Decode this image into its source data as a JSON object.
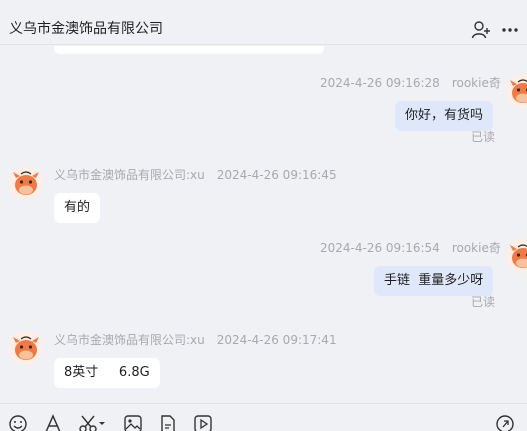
{
  "header": {
    "title": "义乌市金澳饰品有限公司",
    "icons": [
      "add-user-icon",
      "more-icon"
    ]
  },
  "messages": [
    {
      "side": "right",
      "time": "2024-4-26 09:16:28",
      "sender": "rookie奇",
      "text": "你好，有货吗",
      "status": "已读"
    },
    {
      "side": "left",
      "time": "2024-4-26 09:16:45",
      "sender": "义乌市金澳饰品有限公司:xu",
      "text": "有的"
    },
    {
      "side": "right",
      "time": "2024-4-26 09:16:54",
      "sender": "rookie奇",
      "text": "手链  重量多少呀",
      "status": "已读"
    },
    {
      "side": "left",
      "time": "2024-4-26 09:17:41",
      "sender": "义乌市金澳饰品有限公司:xu",
      "text": "8英寸     6.8G"
    }
  ],
  "toolbar": {
    "icons": [
      "emoji-icon",
      "font-icon",
      "scissors-icon",
      "image-icon",
      "file-icon",
      "video-icon",
      "history-icon"
    ]
  },
  "colors": {
    "background": "#f0f1f5",
    "my_bubble": "#dfe8fb",
    "their_bubble": "#ffffff",
    "meta_text": "#a7a9b0",
    "avatar_orange": "#f07a45"
  }
}
